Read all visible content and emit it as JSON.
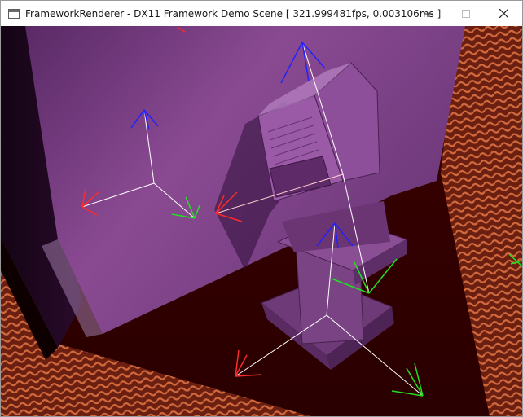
{
  "window": {
    "title": "FrameworkRenderer - DX11 Framework Demo Scene [ 321.999481fps, 0.003106ms ]",
    "icon": "app-window-icon",
    "controls": {
      "minimize_icon": "minimize-icon",
      "maximize_icon": "maximize-icon",
      "close_icon": "close-icon",
      "maximize_enabled": false
    }
  },
  "scene": {
    "description_icon": "3d-viewport",
    "colors": {
      "floor": "#3a0000",
      "wall": "#7a3a82",
      "terrain": "#c8623a",
      "model": "#7a3f86",
      "axis_x": "#ff2a2a",
      "axis_y": "#22e022",
      "axis_z": "#2222ff"
    }
  }
}
